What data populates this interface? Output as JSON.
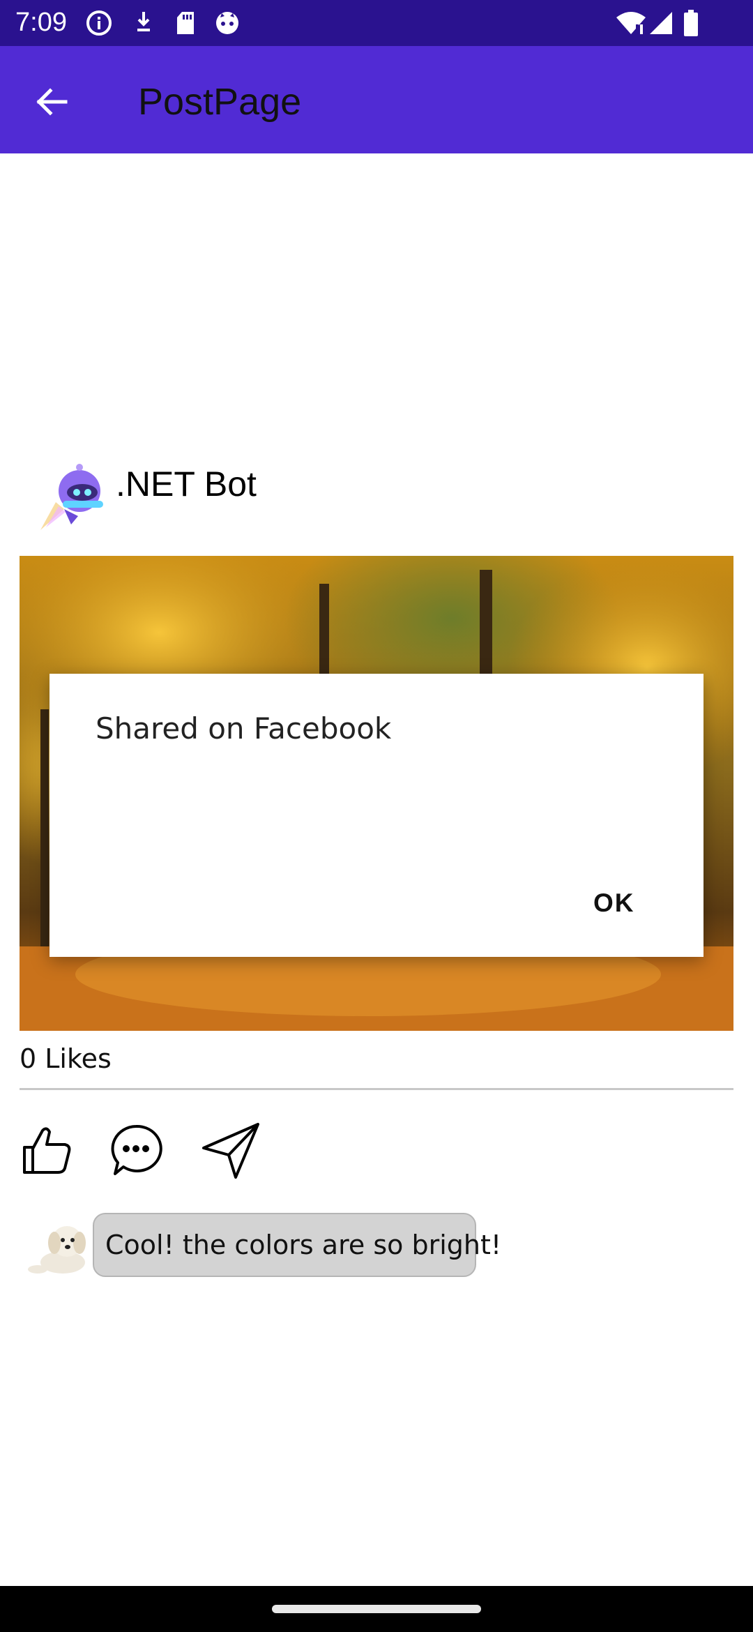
{
  "status_bar": {
    "time": "7:09",
    "icons": [
      "info-icon",
      "download-icon",
      "sd-card-icon",
      "cat-face-icon",
      "wifi-icon",
      "signal-icon",
      "battery-icon"
    ]
  },
  "app_bar": {
    "title": "PostPage",
    "back_icon": "arrow-left-icon",
    "color": "#512bd4"
  },
  "post": {
    "author": ".NET Bot",
    "image_description_icon": "autumn-forest-photo",
    "likes": "0 Likes",
    "actions": [
      "like-icon",
      "comment-icon",
      "share-icon"
    ]
  },
  "comment": {
    "text": "Cool! the colors are so bright!"
  },
  "dialog": {
    "message": "Shared on Facebook",
    "ok_label": "OK"
  }
}
